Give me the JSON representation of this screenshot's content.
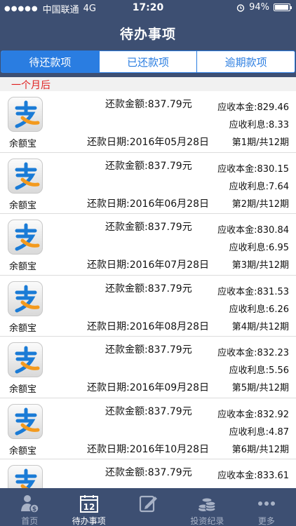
{
  "status": {
    "carrier": "中国联通",
    "network": "4G",
    "time": "17:20",
    "battery": "94%",
    "battery_level": 0.94
  },
  "nav": {
    "title": "待办事项"
  },
  "tabs": [
    {
      "label": "待还款项",
      "active": true
    },
    {
      "label": "已还款项",
      "active": false
    },
    {
      "label": "逾期款项",
      "active": false
    }
  ],
  "section": {
    "label": "一个月后"
  },
  "rows": [
    {
      "name": "余额宝",
      "amount": "还款金额:837.79元",
      "date": "还款日期:2016年05月28日",
      "principal": "应收本金:829.46",
      "interest": "应收利息:8.33",
      "period": "第1期/共12期"
    },
    {
      "name": "余额宝",
      "amount": "还款金额:837.79元",
      "date": "还款日期:2016年06月28日",
      "principal": "应收本金:830.15",
      "interest": "应收利息:7.64",
      "period": "第2期/共12期"
    },
    {
      "name": "余额宝",
      "amount": "还款金额:837.79元",
      "date": "还款日期:2016年07月28日",
      "principal": "应收本金:830.84",
      "interest": "应收利息:6.95",
      "period": "第3期/共12期"
    },
    {
      "name": "余额宝",
      "amount": "还款金额:837.79元",
      "date": "还款日期:2016年08月28日",
      "principal": "应收本金:831.53",
      "interest": "应收利息:6.26",
      "period": "第4期/共12期"
    },
    {
      "name": "余额宝",
      "amount": "还款金额:837.79元",
      "date": "还款日期:2016年09月28日",
      "principal": "应收本金:832.23",
      "interest": "应收利息:5.56",
      "period": "第5期/共12期"
    },
    {
      "name": "余额宝",
      "amount": "还款金额:837.79元",
      "date": "还款日期:2016年10月28日",
      "principal": "应收本金:832.92",
      "interest": "应收利息:4.87",
      "period": "第6期/共12期"
    },
    {
      "name": "",
      "amount": "还款金额:837.79元",
      "date": "",
      "principal": "应收本金:833.61",
      "interest": "",
      "period": ""
    }
  ],
  "tabbar": [
    {
      "label": "首页",
      "icon": "user-money-icon",
      "active": false
    },
    {
      "label": "待办事项",
      "icon": "calendar-12-icon",
      "calendar_day": "12",
      "active": true
    },
    {
      "label": "",
      "icon": "edit-note-icon",
      "active": false
    },
    {
      "label": "投资纪录",
      "icon": "coins-stack-icon",
      "active": false
    },
    {
      "label": "更多",
      "icon": "more-dots-icon",
      "active": false
    }
  ],
  "colors": {
    "nav_bg": "#3d4f72",
    "accent": "#2a7de1",
    "section_text": "#e02020",
    "logo_blue": "#1a7bd6",
    "logo_orange": "#f39a1e"
  }
}
